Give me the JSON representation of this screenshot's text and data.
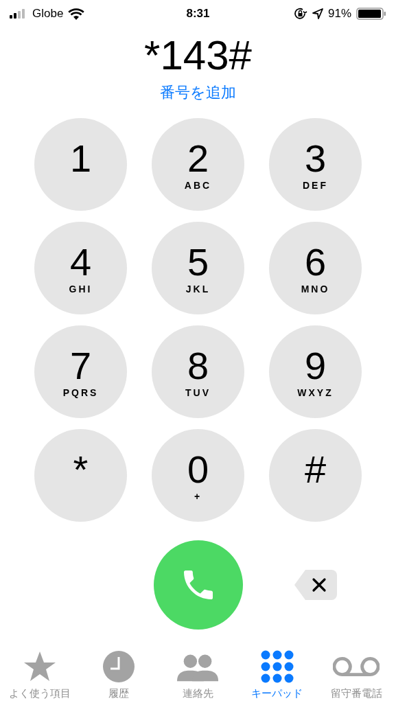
{
  "status_bar": {
    "carrier": "Globe",
    "time": "8:31",
    "battery": "91%"
  },
  "dialed_number": "*143#",
  "add_number_link": "番号を追加",
  "keys": [
    {
      "digit": "1"
    },
    {
      "digit": "2",
      "letters": "ABC"
    },
    {
      "digit": "3",
      "letters": "DEF"
    },
    {
      "digit": "4",
      "letters": "GHI"
    },
    {
      "digit": "5",
      "letters": "JKL"
    },
    {
      "digit": "6",
      "letters": "MNO"
    },
    {
      "digit": "7",
      "letters": "PQRS"
    },
    {
      "digit": "8",
      "letters": "TUV"
    },
    {
      "digit": "9",
      "letters": "WXYZ"
    },
    {
      "digit": "*"
    },
    {
      "digit": "0",
      "letters": "+"
    },
    {
      "digit": "#"
    }
  ],
  "tabs": [
    {
      "kind": "favorites",
      "label": "よく使う項目",
      "selected": false
    },
    {
      "kind": "recents",
      "label": "履歴",
      "selected": false
    },
    {
      "kind": "contacts",
      "label": "連絡先",
      "selected": false
    },
    {
      "kind": "keypad",
      "label": "キーパッド",
      "selected": true
    },
    {
      "kind": "voicemail",
      "label": "留守番電話",
      "selected": false
    }
  ]
}
